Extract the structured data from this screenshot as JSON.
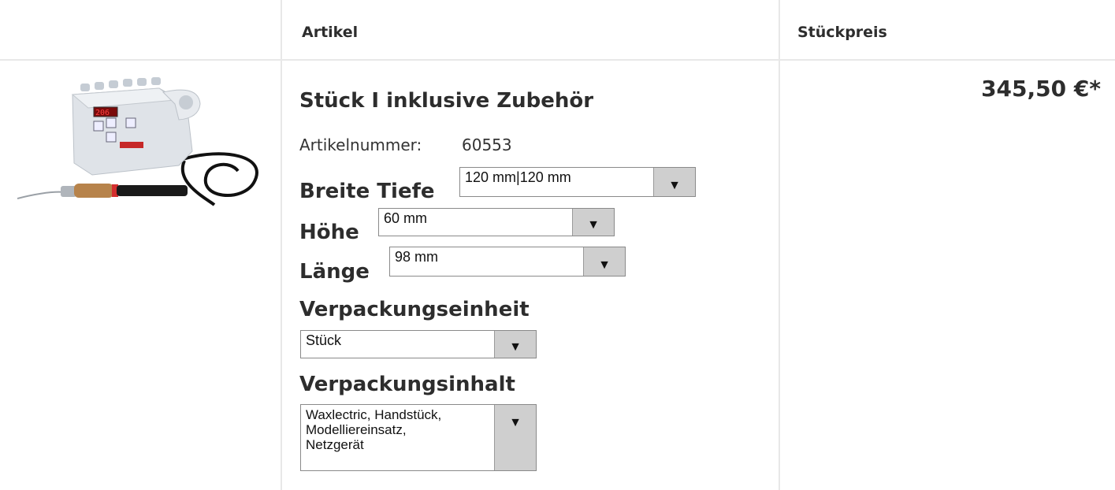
{
  "header": {
    "col_article": "Artikel",
    "col_price": "Stückpreis"
  },
  "product": {
    "title": "Stück I inklusive Zubehör",
    "article_number_label": "Artikelnummer:",
    "article_number": "60553",
    "price": "345,50 €*",
    "image_icon": "waxlectric-device-image",
    "options": [
      {
        "label": "Breite Tiefe",
        "value": "120 mm|120 mm"
      },
      {
        "label": "Höhe",
        "value": "60 mm"
      },
      {
        "label": "Länge",
        "value": "98 mm"
      },
      {
        "label": "Verpackungseinheit",
        "value": "Stück"
      },
      {
        "label": "Verpackungsinhalt",
        "value": "Waxlectric, Handstück,\nModelliereinsatz,\nNetzgerät"
      }
    ]
  },
  "dropdown_arrow": "▼"
}
